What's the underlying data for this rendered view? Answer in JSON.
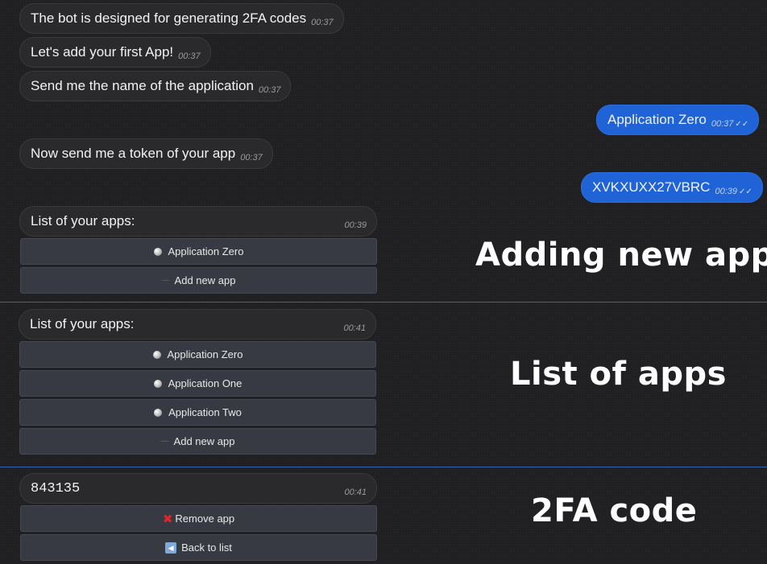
{
  "chat": {
    "m1": {
      "text": "The bot is designed for generating 2FA codes",
      "time": "00:37"
    },
    "m2": {
      "text": "Let's add your first App!",
      "time": "00:37"
    },
    "m3": {
      "text": "Send me the name of the application",
      "time": "00:37"
    },
    "u1": {
      "text": "Application Zero",
      "time": "00:37",
      "ticks": "✓✓"
    },
    "m4": {
      "text": "Now send me a token of your app",
      "time": "00:37"
    },
    "u2": {
      "text": "XVKXUXX27VBRC",
      "time": "00:39",
      "ticks": "✓✓"
    }
  },
  "section1": {
    "caption": "Adding new app",
    "message": {
      "text": "List of your apps:",
      "time": "00:39"
    },
    "buttons": [
      "Application Zero",
      "Add new app"
    ]
  },
  "section2": {
    "caption": "List of apps",
    "message": {
      "text": "List of your apps:",
      "time": "00:41"
    },
    "buttons": [
      "Application Zero",
      "Application One",
      "Application Two",
      "Add new app"
    ]
  },
  "section3": {
    "caption": "2FA code",
    "message": {
      "text": "843135",
      "time": "00:41"
    },
    "buttons": [
      "Remove app",
      "Back to list"
    ]
  },
  "colors": {
    "outgoing_bubble": "#1f63d6",
    "divider": "#3263b8",
    "remove_icon": "#e0262b"
  }
}
